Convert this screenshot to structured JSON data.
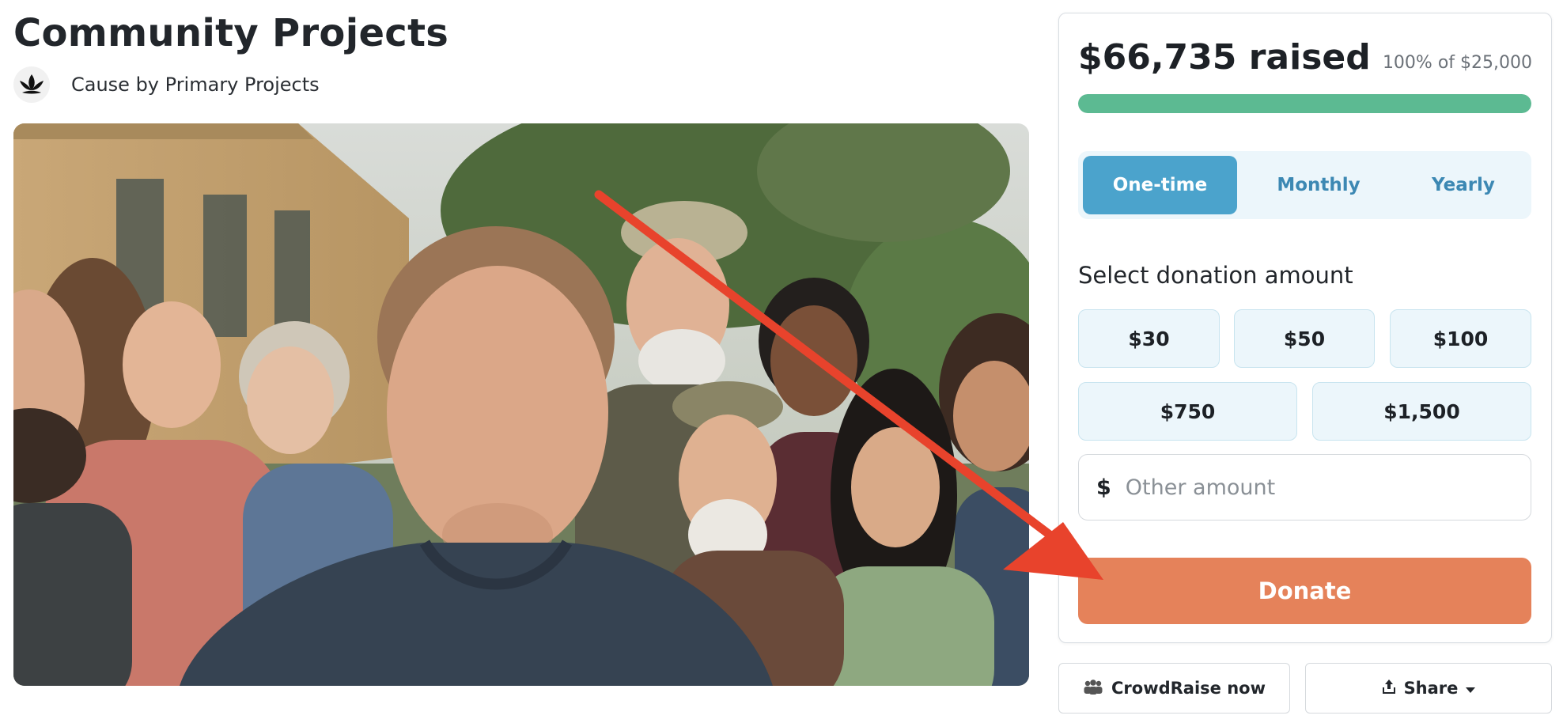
{
  "page": {
    "title": "Community Projects",
    "byline": "Cause by Primary Projects",
    "org_logo_icon": "lotus-leaf-icon"
  },
  "hero_photo": {
    "subject": "group of smiling community volunteers outdoors"
  },
  "donation_card": {
    "raised_text": "$66,735 raised",
    "goal_text": "100% of $25,000",
    "progress_percent": 100,
    "progress_color": "#5cba92",
    "frequency_tabs": [
      {
        "label": "One-time",
        "active": true
      },
      {
        "label": "Monthly",
        "active": false
      },
      {
        "label": "Yearly",
        "active": false
      }
    ],
    "select_label": "Select donation amount",
    "amounts": [
      "$30",
      "$50",
      "$100",
      "$750",
      "$1,500"
    ],
    "other_amount": {
      "currency": "$",
      "placeholder": "Other amount",
      "value": ""
    },
    "donate_label": "Donate",
    "donate_color": "#e5825a"
  },
  "secondary_actions": {
    "crowdraise_label": "CrowdRaise now",
    "crowdraise_icon": "people-group-icon",
    "share_label": "Share",
    "share_icon": "upload-share-icon",
    "share_caret_icon": "caret-down-icon"
  },
  "annotation": {
    "arrow_color": "#e8432c",
    "arrow_icon": "red-arrow-icon"
  }
}
